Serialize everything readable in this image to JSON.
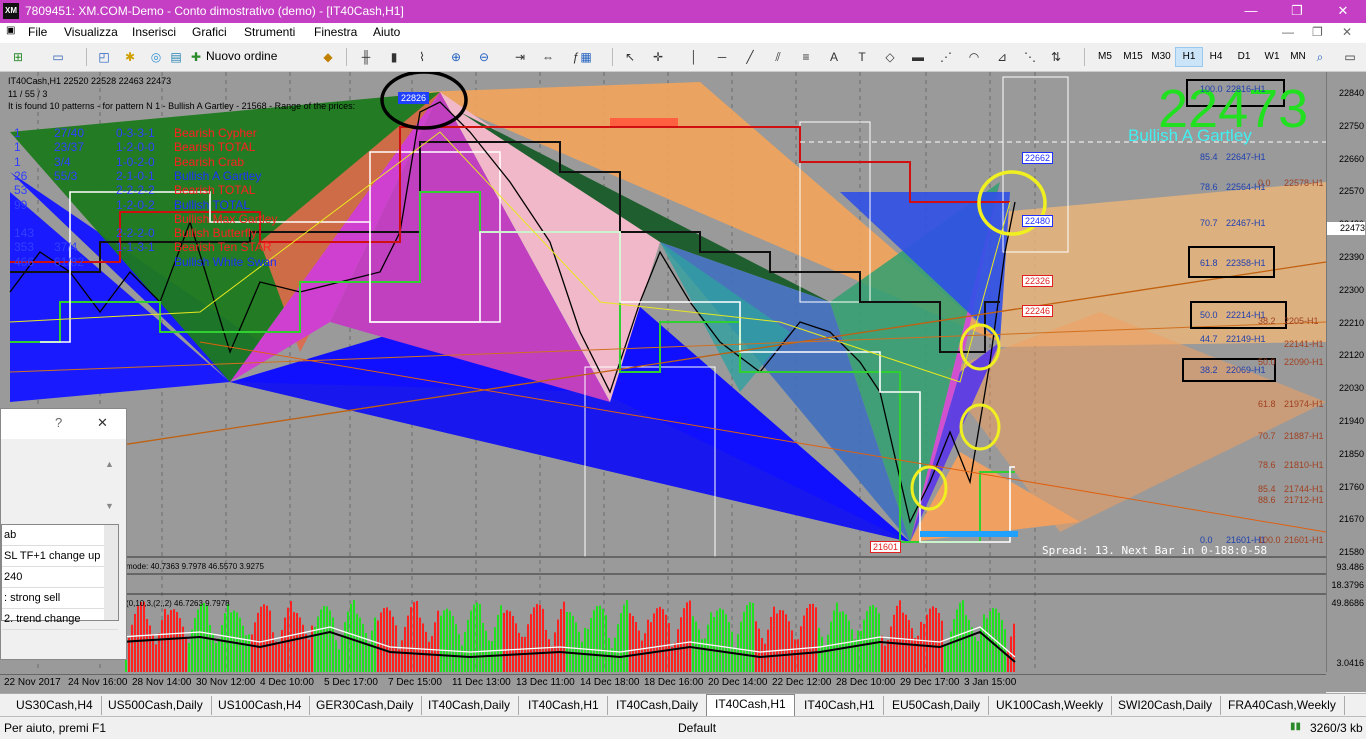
{
  "window": {
    "title": "7809451: XM.COM-Demo - Conto dimostrativo (demo) - [IT40Cash,H1]",
    "app_icon": "XM",
    "minimize": "—",
    "restore": "❐",
    "close": "✕"
  },
  "menu": [
    "File",
    "Visualizza",
    "Inserisci",
    "Grafici",
    "Strumenti",
    "Finestra",
    "Aiuto"
  ],
  "toolbar": {
    "new_order": "Nuovo ordine",
    "timeframes": [
      "M5",
      "M15",
      "M30",
      "H1",
      "H4",
      "D1",
      "W1",
      "MN"
    ],
    "active_timeframe": "H1"
  },
  "chart": {
    "header": "IT40Cash,H1  22520 22528 22463 22473",
    "sub1": "11 / 55 / 3",
    "sub2": "It is found 10 patterns  -  for pattern N 1 - Bullish A Gartley - 21568 - Range of the prices:",
    "big_price": "22473",
    "big_pattern": "Bullish A Gartley",
    "current_price": "22473",
    "pattern_table": [
      {
        "col1": "1",
        "col2": "27/40",
        "col3": "0-3-3-1",
        "name": "Bearish Cypher",
        "color": "#ff2020"
      },
      {
        "col1": "1",
        "col2": "23/37",
        "col3": "1-2-0-0",
        "name": "Bearish TOTAL",
        "color": "#ff2020"
      },
      {
        "col1": "1",
        "col2": "3/4",
        "col3": "1-0-2-0",
        "name": "Bearish Crab",
        "color": "#ff2020"
      },
      {
        "col1": "26",
        "col2": "55/3",
        "col3": "2-1-0-1",
        "name": "Bullish A Gartley",
        "color": "#2030ff"
      },
      {
        "col1": "53",
        "col2": "",
        "col3": "2-2-2-2",
        "name": "Bearish TOTAL",
        "color": "#ff2020"
      },
      {
        "col1": "99",
        "col2": "",
        "col3": "1-2-0-2",
        "name": "Bullish TOTAL",
        "color": "#2030ff"
      },
      {
        "col1": "",
        "col2": "",
        "col3": "",
        "name": "Bullish Max Gartley",
        "color": "#ff2020"
      },
      {
        "col1": "143",
        "col2": "",
        "col3": "2-2-2-0",
        "name": "Bullish Butterfly",
        "color": "#ff2020"
      },
      {
        "col1": "353",
        "col2": "37/4",
        "col3": "1-1-3-1",
        "name": "Bearish Ten STAR",
        "color": "#ff2020"
      },
      {
        "col1": "466",
        "col2": "61/82",
        "col3": "",
        "name": "Bullish White Swan",
        "color": "#2030ff"
      }
    ],
    "price_labels": [
      "22840",
      "22750",
      "22660",
      "22570",
      "22480",
      "22390",
      "22300",
      "22210",
      "22120",
      "22030",
      "21940",
      "21850",
      "21760",
      "21670",
      "21580"
    ],
    "sub_scale": [
      "93.486",
      "18.3796",
      "49.8686",
      "3.0416"
    ],
    "box_labels": {
      "top": "22826",
      "b1": "22662",
      "b2": "22480",
      "b3": "22326",
      "b4": "22246",
      "bottom": "21601"
    },
    "fib_left": [
      {
        "ratio": "100.0",
        "value": "22816-H1"
      },
      {
        "ratio": "85.4",
        "value": "22647-H1"
      },
      {
        "ratio": "78.6",
        "value": "22564-H1"
      },
      {
        "ratio": "70.7",
        "value": "22467-H1"
      },
      {
        "ratio": "61.8",
        "value": "22358-H1"
      },
      {
        "ratio": "50.0",
        "value": "22214-H1"
      },
      {
        "ratio": "44.7",
        "value": "22149-H1"
      },
      {
        "ratio": "38.2",
        "value": "22069-H1"
      },
      {
        "ratio": "0.0",
        "value": "21601-H1"
      }
    ],
    "fib_right": [
      {
        "ratio": "0.0",
        "value": "22578-H1"
      },
      {
        "ratio": "38.2",
        "value": "2205-H1"
      },
      {
        "ratio": "",
        "value": "22141-H1"
      },
      {
        "ratio": "50.0",
        "value": "22090-H1"
      },
      {
        "ratio": "61.8",
        "value": "21974-H1"
      },
      {
        "ratio": "70.7",
        "value": "21887-H1"
      },
      {
        "ratio": "78.6",
        "value": "21810-H1"
      },
      {
        "ratio": "85.4",
        "value": "21744-H1"
      },
      {
        "ratio": "88.6",
        "value": "21712-H1"
      },
      {
        "ratio": "100.0",
        "value": "21601-H1"
      }
    ],
    "spread_text": "Spread: 13. Next Bar in 0-188:0-58",
    "indicator1": "mode: 40.7363 9.7978 46.5570 3.9275",
    "indicator2": "(0,10,3,(2,,2) 46.7263 9.7978",
    "time_labels": [
      "22 Nov 2017",
      "24 Nov 16:00",
      "28 Nov 14:00",
      "30 Nov 12:00",
      "4 Dec 10:00",
      "5 Dec 17:00",
      "7 Dec 15:00",
      "11 Dec 13:00",
      "13 Dec 11:00",
      "14 Dec 18:00",
      "18 Dec 16:00",
      "20 Dec 14:00",
      "22 Dec 12:00",
      "28 Dec 10:00",
      "29 Dec 17:00",
      "3 Jan 15:00"
    ]
  },
  "dialog": {
    "help": "?",
    "close": "✕",
    "rows": [
      "ab",
      "SL TF+1 change up",
      "240",
      ": strong sell",
      "2. trend change"
    ]
  },
  "tabs": [
    "US30Cash,H4",
    "US500Cash,Daily",
    "US100Cash,H4",
    "GER30Cash,Daily",
    "IT40Cash,Daily",
    "IT40Cash,H1",
    "IT40Cash,Daily",
    "IT40Cash,H1",
    "IT40Cash,H1",
    "EU50Cash,Daily",
    "UK100Cash,Weekly",
    "SWI20Cash,Daily",
    "FRA40Cash,Weekly"
  ],
  "active_tab": 7,
  "status": {
    "help": "Per aiuto, premi F1",
    "profile": "Default",
    "traffic": "3260/3 kb"
  }
}
